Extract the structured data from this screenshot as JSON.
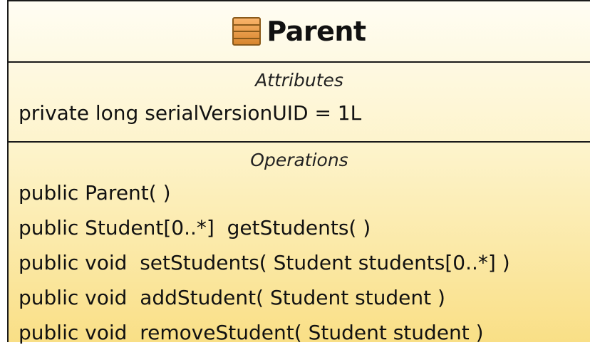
{
  "class": {
    "name": "Parent",
    "icon": "uml-class-icon"
  },
  "attributes": {
    "title": "Attributes",
    "items": [
      "private long serialVersionUID = 1L"
    ]
  },
  "operations": {
    "title": "Operations",
    "items": [
      "public Parent( )",
      "public Student[0..*]  getStudents( )",
      "public void  setStudents( Student students[0..*] )",
      "public void  addStudent( Student student )",
      "public void  removeStudent( Student student )"
    ]
  },
  "colors": {
    "border": "#1a1a1a",
    "fill_top": "#fffdf3",
    "fill_bottom": "#f9df86",
    "icon": "#d8862e"
  }
}
